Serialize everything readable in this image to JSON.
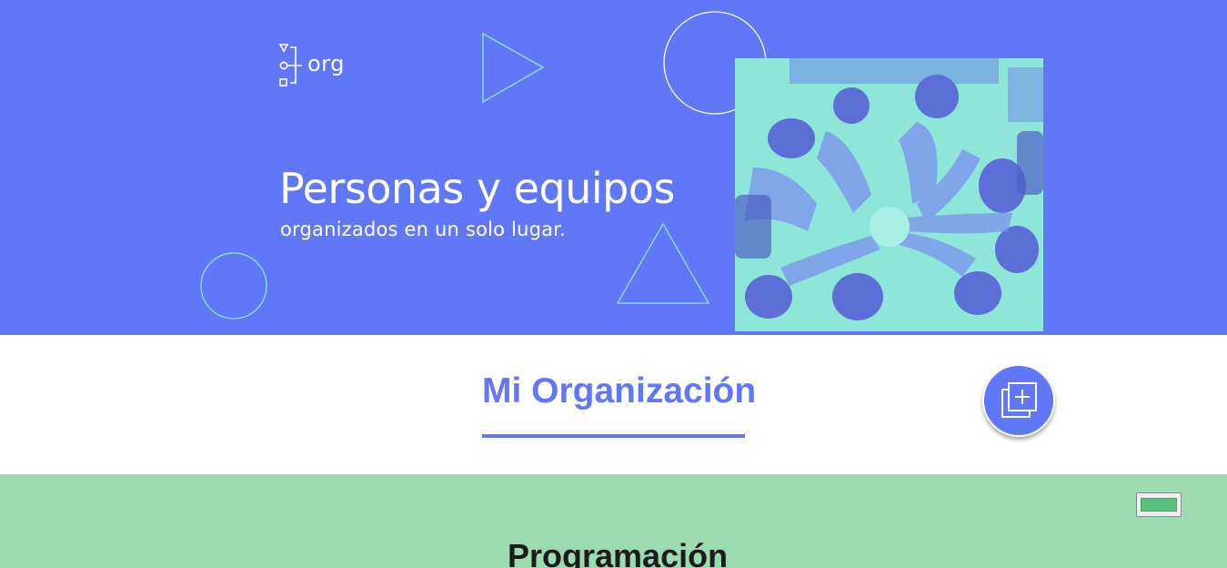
{
  "hero": {
    "logo_text": "org",
    "title": "Personas y equipos",
    "subtitle": "organizados en un solo lugar.",
    "colors": {
      "background": "#6078f7",
      "accent": "#8ee6d8",
      "text": "#ffffff"
    }
  },
  "section": {
    "title": "Mi Organización",
    "add_button_icon": "add-copy-icon",
    "color": "#6078f7"
  },
  "program": {
    "title": "Programación",
    "background": "#9cdbb0",
    "toggle_color": "#59c17e"
  }
}
